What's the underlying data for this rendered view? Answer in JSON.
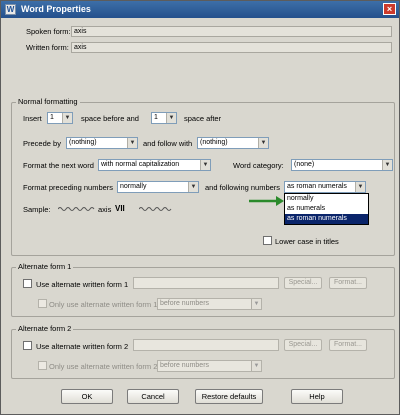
{
  "window": {
    "title": "Word Properties"
  },
  "header": {
    "spoken_label": "Spoken form:",
    "spoken_value": "axis",
    "written_label": "Written form:",
    "written_value": "axis"
  },
  "normal": {
    "legend": "Normal formatting",
    "insert_label": "Insert",
    "before_count": "1",
    "space_before_label": "space before and",
    "after_count": "1",
    "space_after_label": "space after",
    "preceded_label": "Precede by",
    "preceded_value": "(nothing)",
    "follow_label": "and follow with",
    "follow_value": "(nothing)",
    "format_next_label": "Format the next word",
    "format_next_value": "with normal capitalization",
    "category_label": "Word category:",
    "category_value": "(none)",
    "format_preceding_label": "Format preceding numbers",
    "preceding_value": "normally",
    "following_label": "and following numbers",
    "following_value": "as roman numerals",
    "following_options": [
      "normally",
      "as numerals",
      "as roman numerals"
    ],
    "following_selected_index": 2,
    "sample_label": "Sample:",
    "sample_word": "axis",
    "sample_numeral": "VII",
    "lowercase_label": "Lower case in titles"
  },
  "alt1": {
    "legend": "Alternate form 1",
    "use_label": "Use alternate written form 1",
    "only_label": "Only use alternate written form 1",
    "only_value": "before numbers",
    "special_label": "Special...",
    "format_label": "Format..."
  },
  "alt2": {
    "legend": "Alternate form 2",
    "use_label": "Use alternate written form 2",
    "only_label": "Only use alternate written form 2",
    "only_value": "before numbers",
    "special_label": "Special...",
    "format_label": "Format..."
  },
  "buttons": {
    "ok": "OK",
    "cancel": "Cancel",
    "restore": "Restore defaults",
    "help": "Help"
  },
  "colors": {
    "titlebar": "#24508c",
    "selection": "#0a246a",
    "arrow": "#2b8a2b"
  },
  "icons": {
    "close": "close-icon",
    "app": "app-icon",
    "arrow": "arrow-pointer-icon"
  }
}
